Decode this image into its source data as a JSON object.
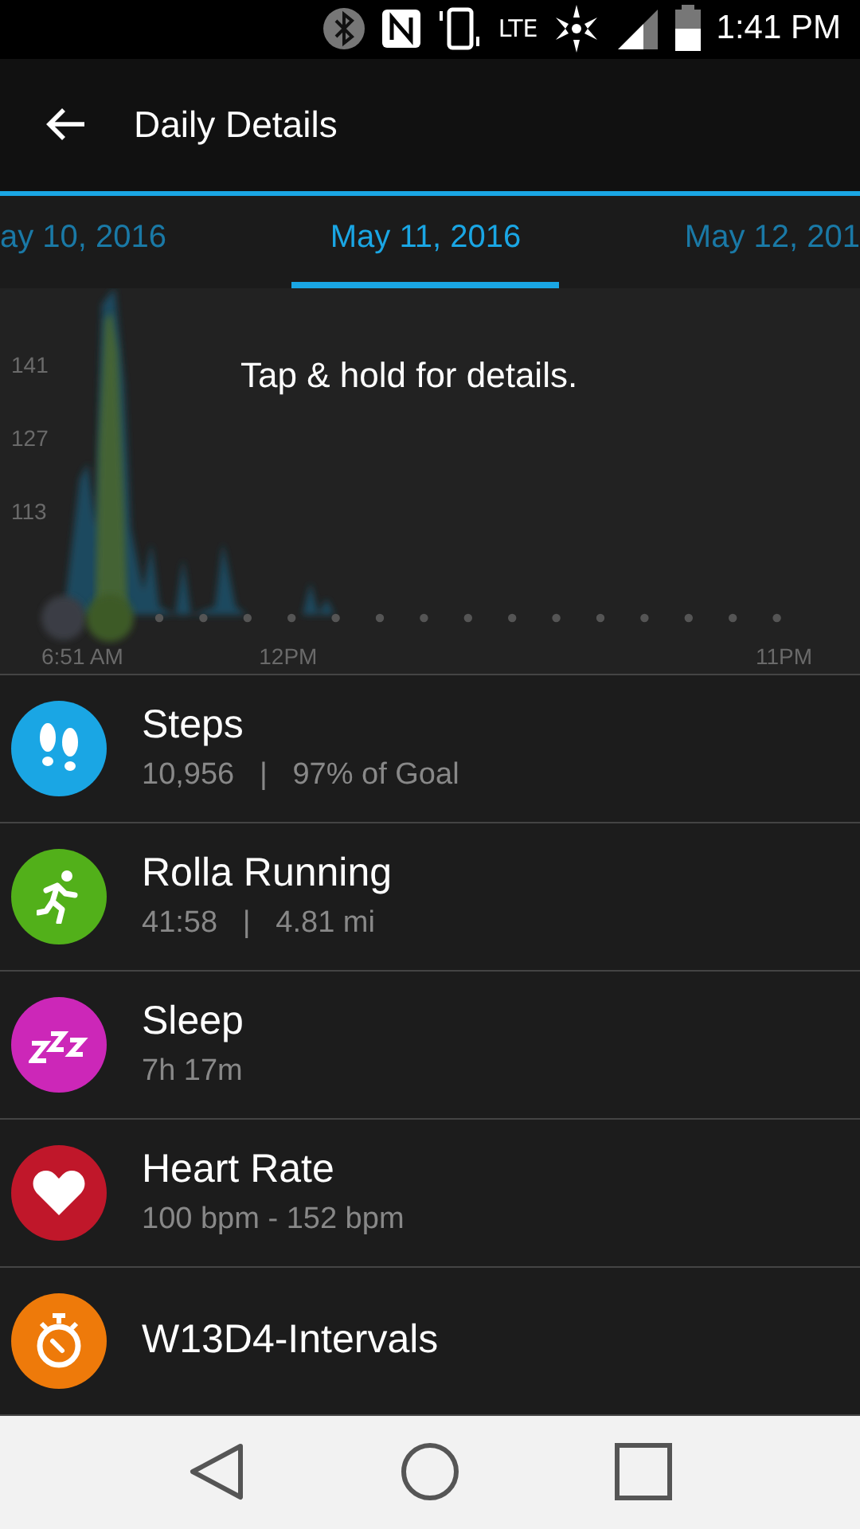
{
  "status_bar": {
    "network": "LTE",
    "time": "1:41 PM"
  },
  "app_bar": {
    "title": "Daily Details"
  },
  "date_tabs": [
    {
      "label": "ay 10, 2016",
      "selected": false
    },
    {
      "label": "May 11, 2016",
      "selected": true
    },
    {
      "label": "May 12, 201",
      "selected": false
    }
  ],
  "chart": {
    "hint": "Tap & hold for details.",
    "y_labels": [
      "141",
      "127",
      "113"
    ],
    "x_labels": [
      "6:51 AM",
      "12PM",
      "11PM"
    ]
  },
  "activities": [
    {
      "kind": "steps",
      "title": "Steps",
      "detail": "10,956   |   97% of Goal",
      "color": "#1aa6e4"
    },
    {
      "kind": "running",
      "title": "Rolla Running",
      "detail": "41:58   |   4.81 mi",
      "color": "#52b01a"
    },
    {
      "kind": "sleep",
      "title": "Sleep",
      "detail": "7h 17m",
      "color": "#cc27b8"
    },
    {
      "kind": "heart",
      "title": "Heart Rate",
      "detail": "100 bpm - 152 bpm",
      "color": "#c0172a"
    },
    {
      "kind": "workout",
      "title": "W13D4-Intervals",
      "color": "#ee7a0a"
    }
  ]
}
